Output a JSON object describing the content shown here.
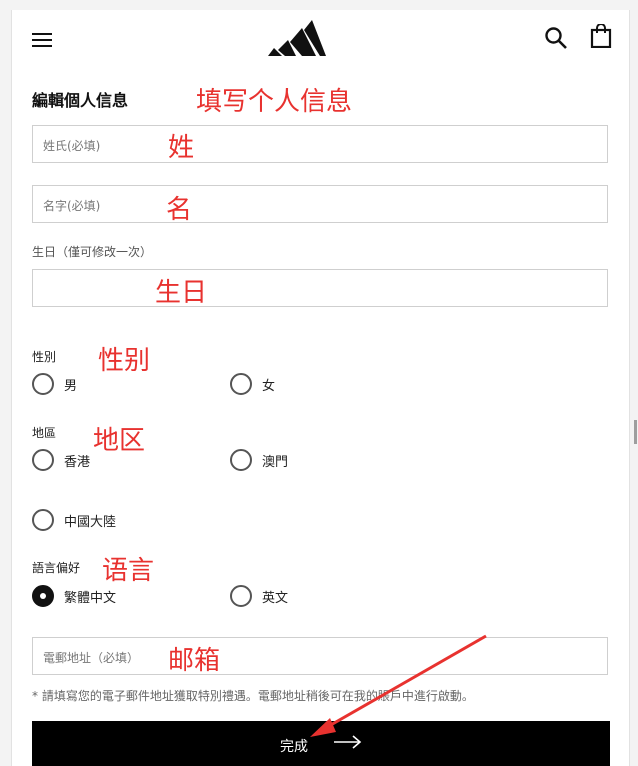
{
  "header": {
    "menu_icon": "hamburger-menu-icon",
    "logo": "adidas-logo",
    "search_icon": "search-icon",
    "bag_icon": "shopping-bag-icon"
  },
  "form": {
    "title": "編輯個人信息",
    "last_name_placeholder": "姓氏(必填)",
    "first_name_placeholder": "名字(必填)",
    "birthday_label": "生日（僅可修改一次）",
    "birthday_value": "",
    "gender_label": "性別",
    "gender_options": [
      "男",
      "女"
    ],
    "region_label": "地區",
    "region_options": [
      "香港",
      "澳門",
      "中國大陸"
    ],
    "language_label": "語言偏好",
    "language_options": [
      "繁體中文",
      "英文"
    ],
    "language_selected": "繁體中文",
    "email_placeholder": "電郵地址（必填）",
    "note": "* 請填寫您的電子郵件地址獲取特別禮遇。電郵地址稍後可在我的賬戶中進行啟動。",
    "submit_label": "完成"
  },
  "annotations": {
    "title": "填写个人信息",
    "last_name": "姓",
    "first_name": "名",
    "birthday": "生日",
    "gender": "性别",
    "region": "地区",
    "language": "语言",
    "email": "邮箱"
  },
  "colors": {
    "annotation": "#e8322f",
    "button_bg": "#000000"
  }
}
